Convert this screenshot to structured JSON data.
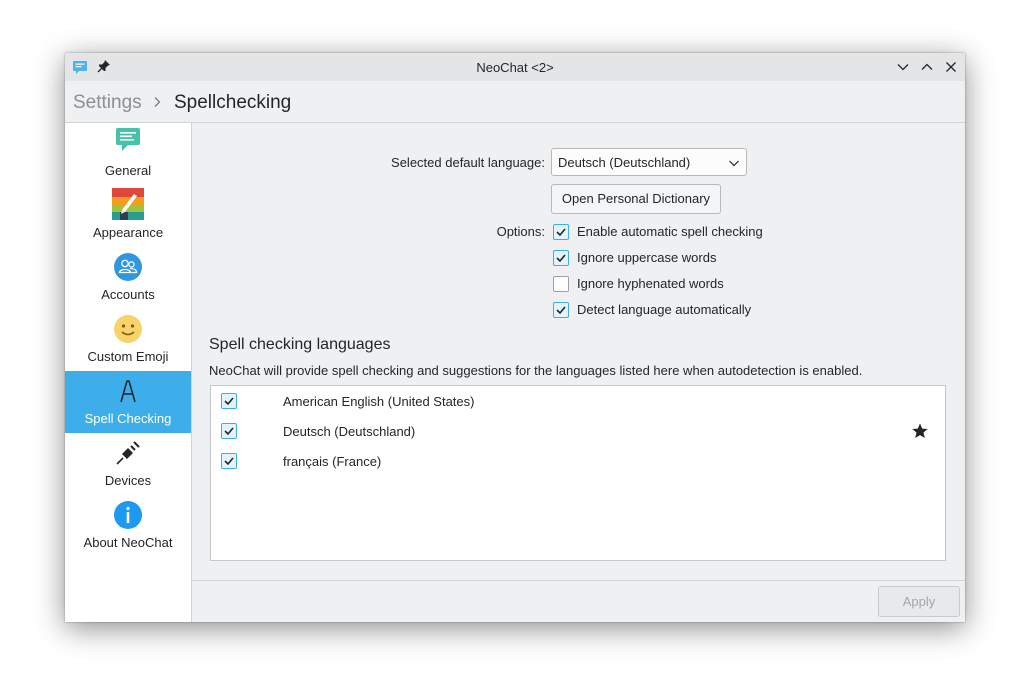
{
  "window": {
    "title": "NeoChat <2>"
  },
  "header": {
    "breadcrumb_root": "Settings",
    "breadcrumb_current": "Spellchecking"
  },
  "sidebar": {
    "items": [
      {
        "label": "General",
        "icon": "general-settings-icon"
      },
      {
        "label": "Appearance",
        "icon": "appearance-icon"
      },
      {
        "label": "Accounts",
        "icon": "accounts-icon"
      },
      {
        "label": "Custom Emoji",
        "icon": "emoji-icon"
      },
      {
        "label": "Spell Checking",
        "icon": "spellcheck-icon",
        "active": true
      },
      {
        "label": "Devices",
        "icon": "devices-icon"
      },
      {
        "label": "About NeoChat",
        "icon": "about-icon"
      }
    ]
  },
  "form": {
    "default_language_label": "Selected default language:",
    "default_language_value": "Deutsch (Deutschland)",
    "personal_dictionary_button": "Open Personal Dictionary",
    "options_label": "Options:",
    "options": [
      {
        "label": "Enable automatic spell checking",
        "checked": true
      },
      {
        "label": "Ignore uppercase words",
        "checked": true
      },
      {
        "label": "Ignore hyphenated words",
        "checked": false
      },
      {
        "label": "Detect language automatically",
        "checked": true
      }
    ]
  },
  "languages_section": {
    "title": "Spell checking languages",
    "description": "NeoChat will provide spell checking and suggestions for the languages listed here when autodetection is enabled.",
    "languages": [
      {
        "name": "American English (United States)",
        "checked": true,
        "default": false
      },
      {
        "name": "Deutsch (Deutschland)",
        "checked": true,
        "default": true
      },
      {
        "name": "français (France)",
        "checked": true,
        "default": false
      }
    ]
  },
  "footer": {
    "apply_label": "Apply"
  },
  "colors": {
    "accent": "#3daee9",
    "window_bg": "#eff0f1",
    "titlebar_bg": "#e3e5e7"
  }
}
